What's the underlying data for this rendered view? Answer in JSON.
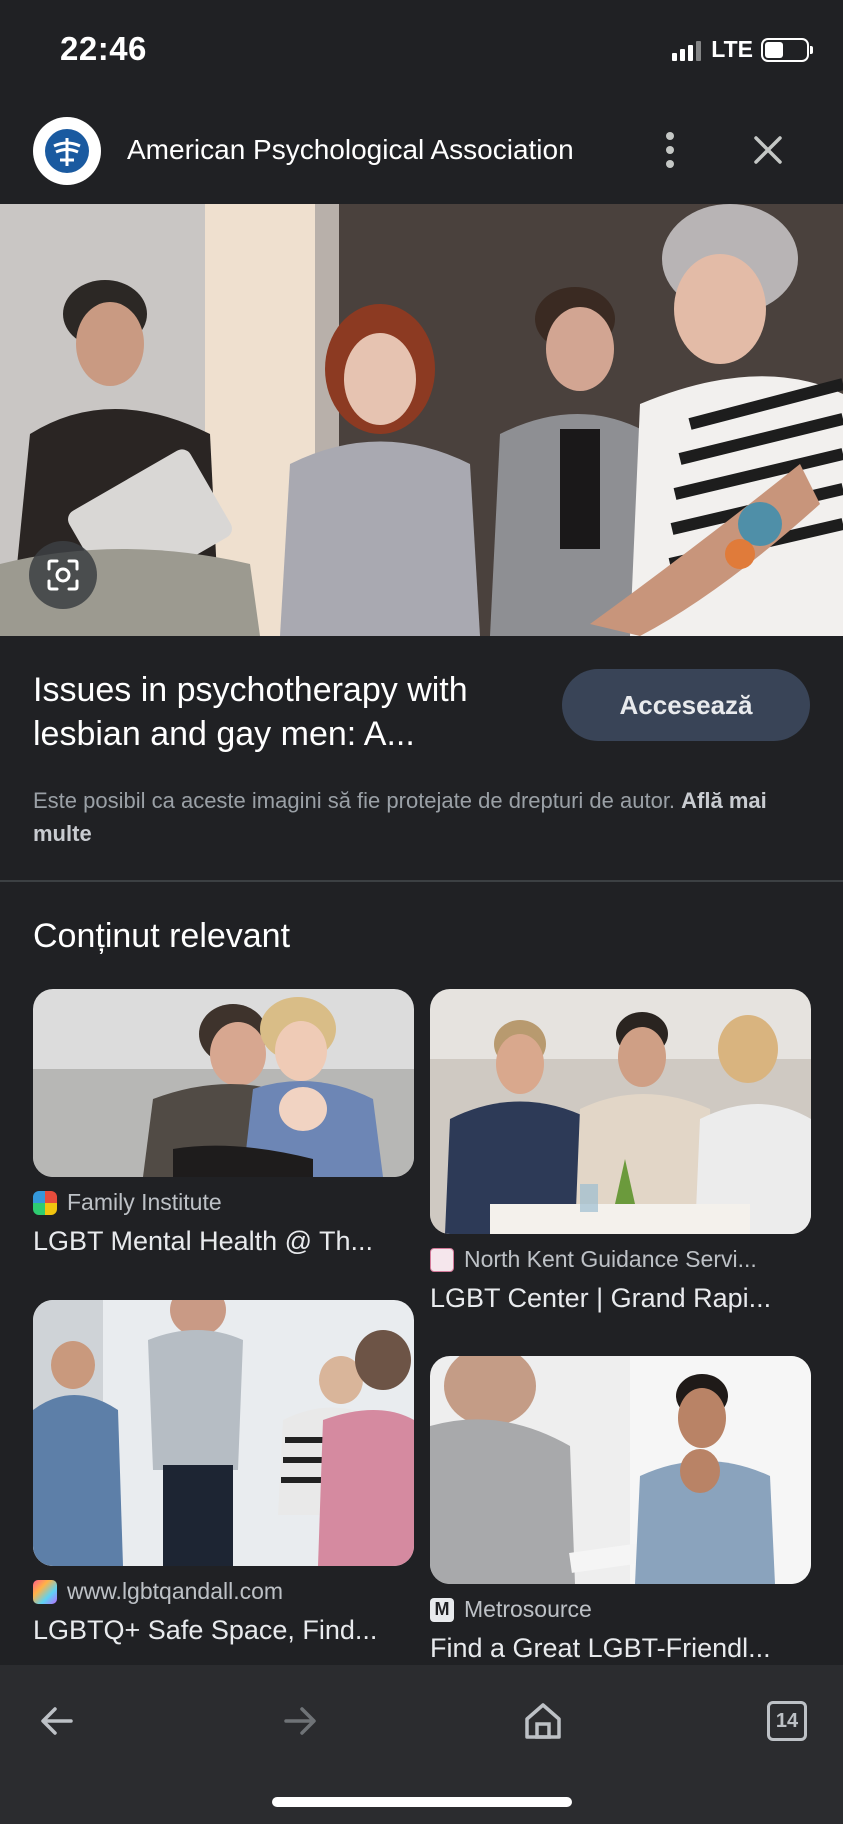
{
  "status": {
    "time": "22:46",
    "network": "LTE"
  },
  "header": {
    "site_name": "American Psychological Association",
    "logo_icon": "apa-logo-icon",
    "menu_icon": "more-vert-icon",
    "close_icon": "close-icon"
  },
  "result": {
    "title": "Issues in psychotherapy with lesbian and gay men: A...",
    "visit_label": "Accesează",
    "copyright_text": "Este posibil ca aceste imagini să fie protejate de drepturi de autor.",
    "learn_more": "Află mai multe"
  },
  "related": {
    "heading": "Conținut relevant",
    "items": [
      {
        "source": "Family Institute",
        "title": "LGBT Mental Health @ Th..."
      },
      {
        "source": "North Kent Guidance Servi...",
        "title": "LGBT Center | Grand Rapi..."
      },
      {
        "source": "www.lgbtqandall.com",
        "title": "LGBTQ+ Safe Space, Find..."
      },
      {
        "source": "Metrosource",
        "title": "Find a Great LGBT-Friendl..."
      }
    ]
  },
  "nav": {
    "back_icon": "arrow-back-icon",
    "forward_icon": "arrow-forward-icon",
    "home_icon": "home-icon",
    "tab_count": "14"
  },
  "colors": {
    "background": "#202124",
    "button": "#394457",
    "nav_bar": "#2b2c2f"
  }
}
